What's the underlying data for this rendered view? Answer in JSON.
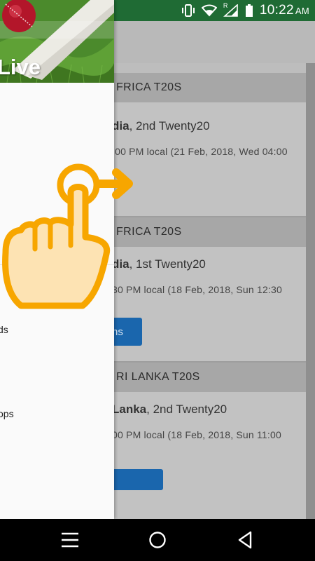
{
  "status_bar": {
    "time": "10:22",
    "ampm": "AM",
    "network_label": "R",
    "icons": [
      "vibrate-icon",
      "wifi-icon",
      "signal-icon",
      "battery-icon"
    ]
  },
  "drawer": {
    "title": "Live",
    "items": [
      {
        "label": "ds"
      },
      {
        "label": "ops"
      }
    ]
  },
  "matches": [
    {
      "series": "FRICA T20S",
      "team": "dia",
      "title_rest": ", 2nd Twenty20",
      "time": ":00 PM local (21 Feb, 2018, Wed 04:00"
    },
    {
      "series": "FRICA T20S",
      "team": "dia",
      "title_rest": ", 1st Twenty20",
      "time": "30 PM local (18 Feb, 2018, Sun 12:30",
      "button": "ns"
    },
    {
      "series": "RI LANKA T20S",
      "team": "Lanka",
      "title_rest": ", 2nd Twenty20",
      "time": "00 PM local (18 Feb, 2018, Sun 11:00"
    }
  ],
  "colors": {
    "status_bar": "#1f6b34",
    "hint": "#f7a600",
    "button": "#1a66ad"
  }
}
